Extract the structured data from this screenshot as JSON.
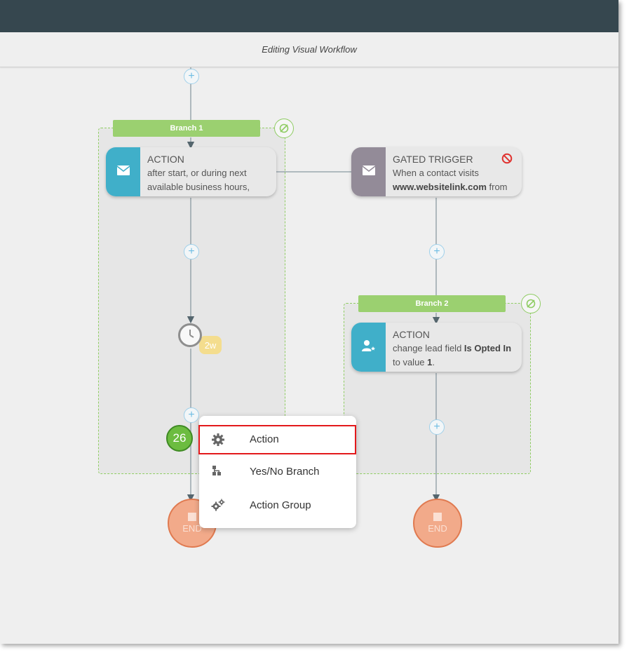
{
  "header": {
    "title": "Editing Visual Workflow"
  },
  "colors": {
    "topbar": "#36474f",
    "branch_green": "#9bd070",
    "action_blue": "#40afc9",
    "gated_gray": "#938b98",
    "end_orange": "#f2aa8a",
    "selection_red": "#e3191b"
  },
  "branches": [
    {
      "label": "Branch 1",
      "icon": "reset-branch-icon"
    },
    {
      "label": "Branch 2",
      "icon": "reset-branch-icon"
    }
  ],
  "cards": {
    "action1": {
      "heading": "ACTION",
      "line1": "after start, or during next",
      "line2": "available business hours,",
      "icon": "envelope-icon"
    },
    "gated": {
      "heading": "GATED TRIGGER",
      "line1": "When a contact visits",
      "line2_bold": "www.websitelink.com",
      "line2_rest": " from",
      "icon": "envelope-icon",
      "status_icon": "prohibited-icon"
    },
    "action2": {
      "heading": "ACTION",
      "line1_pre": "change lead field ",
      "line1_bold": "Is Opted In",
      "line2_pre": "to value ",
      "line2_bold": "1",
      "line2_post": ".",
      "icon": "user-star-icon"
    }
  },
  "wait": {
    "badge": "2w",
    "icon": "clock-icon"
  },
  "counter": {
    "value": "26"
  },
  "end_nodes": [
    {
      "label": "END"
    },
    {
      "label": "END"
    }
  ],
  "context_menu": {
    "items": [
      {
        "label": "Action",
        "icon": "gear-icon",
        "selected": true
      },
      {
        "label": "Yes/No Branch",
        "icon": "branch-icon",
        "selected": false
      },
      {
        "label": "Action Group",
        "icon": "gears-icon",
        "selected": false
      }
    ]
  }
}
